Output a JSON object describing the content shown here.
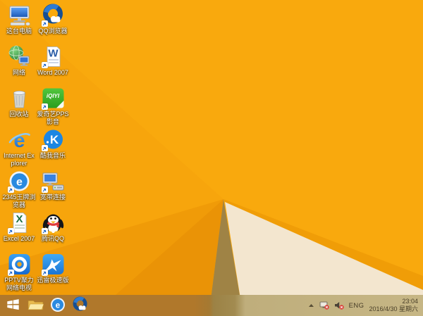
{
  "wallpaper": {
    "base_color": "#F9A90D",
    "facet_colors": {
      "left_facet": "#F7A50C",
      "lower_left_facet": "#F09B08",
      "dark_wedge": "#EA9306",
      "shadow_wedge": "#9F8345",
      "band_above_white": "#F09D07",
      "cream_triangle": "#F3E6CF"
    }
  },
  "desktop": {
    "icons": [
      {
        "name": "this-pc",
        "label": "这台电脑",
        "shortcut": false
      },
      {
        "name": "network",
        "label": "网络",
        "shortcut": false
      },
      {
        "name": "recycle-bin",
        "label": "回收站",
        "shortcut": false
      },
      {
        "name": "internet-explorer",
        "label": "Internet Explorer",
        "glyph": "e",
        "shortcut": false
      },
      {
        "name": "2345-browser",
        "label": "2345王牌浏览器",
        "glyph": "e",
        "shortcut": true
      },
      {
        "name": "excel-2007",
        "label": "Excel 2007",
        "glyph": "X",
        "shortcut": true
      },
      {
        "name": "pptv",
        "label": "PPTV聚力 网络电视",
        "shortcut": true
      },
      {
        "name": "qq-browser",
        "label": "QQ浏览器",
        "shortcut": true
      },
      {
        "name": "word-2007",
        "label": "Word 2007",
        "glyph": "W",
        "shortcut": true
      },
      {
        "name": "iqiyi-pps",
        "label": "爱奇艺PPS 影音",
        "glyph": "iQIYI",
        "shortcut": true
      },
      {
        "name": "kuwo-music",
        "label": "酷我音乐",
        "glyph": "K",
        "shortcut": true
      },
      {
        "name": "broadband",
        "label": "宽带连接",
        "shortcut": true
      },
      {
        "name": "tencent-qq",
        "label": "腾讯QQ",
        "shortcut": true
      },
      {
        "name": "xunlei",
        "label": "迅雷极速版",
        "shortcut": true
      }
    ]
  },
  "taskbar": {
    "buttons": [
      {
        "name": "start"
      },
      {
        "name": "file-explorer"
      },
      {
        "name": "2345-browser",
        "glyph": "e"
      },
      {
        "name": "qq-browser"
      }
    ],
    "tray": {
      "icons": [
        "hidden-icons-chevron",
        "network-disconnected",
        "volume-muted"
      ],
      "lang": "ENG",
      "time": "23:04",
      "date": "2016/4/30 星期六"
    }
  }
}
